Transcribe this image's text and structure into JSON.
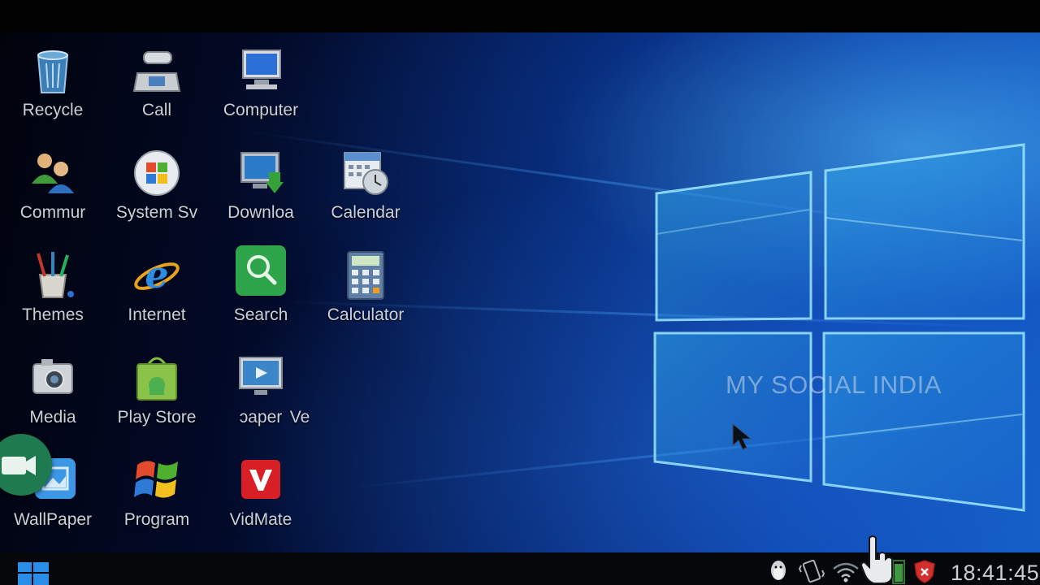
{
  "desktop_icons": [
    {
      "label": "Recycle",
      "icon": "recycle-bin-icon"
    },
    {
      "label": "Call",
      "icon": "telephone-icon"
    },
    {
      "label": "Computer",
      "icon": "computer-icon"
    },
    {
      "label": "Commur",
      "icon": "community-users-icon"
    },
    {
      "label": "System Sv",
      "icon": "windows-orb-icon"
    },
    {
      "label": "Downloa",
      "icon": "download-monitor-icon"
    },
    {
      "label": "Calendar",
      "icon": "calendar-clock-icon"
    },
    {
      "label": "Themes",
      "icon": "paint-brushes-icon"
    },
    {
      "label": "Internet",
      "icon": "internet-explorer-icon"
    },
    {
      "label": "Search",
      "icon": "search-icon"
    },
    {
      "label": "Calculator",
      "icon": "calculator-icon"
    },
    {
      "label": "Media",
      "icon": "camera-icon"
    },
    {
      "label": "Play Store",
      "icon": "play-store-bag-icon"
    },
    {
      "label": "ɔaper",
      "icon": "wallpaper-video-icon"
    },
    {
      "label": "Ve",
      "icon": ""
    },
    {
      "label": "WallPaper",
      "icon": "wallpaper-picture-icon"
    },
    {
      "label": "Program",
      "icon": "windows-flag-icon"
    },
    {
      "label": "VidMate",
      "icon": "vidmate-icon"
    }
  ],
  "watermark": "MY SOCIAL INDIA",
  "taskbar": {
    "clock": "18:41:45",
    "tray_icons": [
      "qq-penguin-icon",
      "phone-vibrate-icon",
      "wifi-icon",
      "battery-icon",
      "shield-icon"
    ]
  },
  "colors": {
    "accent_search": "#2ea54a",
    "accent_vidmate": "#d81f26",
    "fab_green": "#1f7a4f"
  }
}
